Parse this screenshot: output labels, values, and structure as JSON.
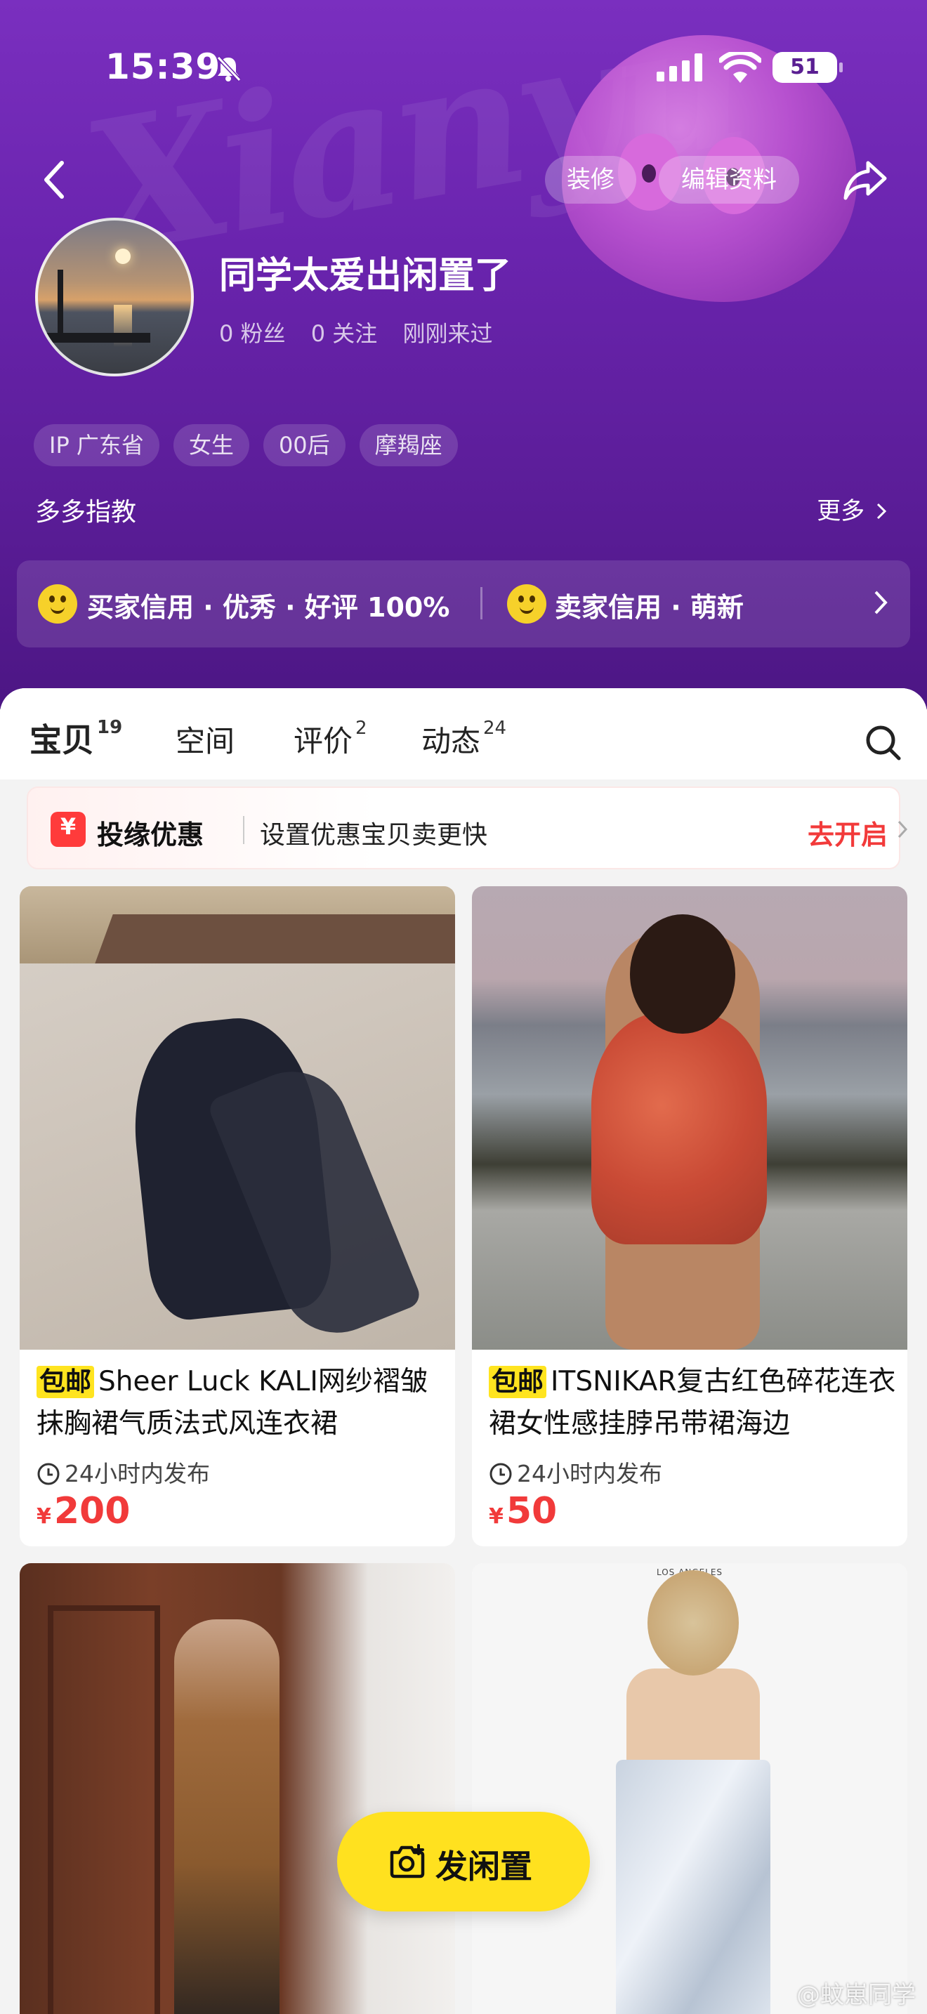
{
  "status_bar": {
    "time": "15:39",
    "battery": "51"
  },
  "header": {
    "background_word": "Xianyu",
    "decorate_label": "装修",
    "edit_label": "编辑资料"
  },
  "profile": {
    "name": "同学太爱出闲置了",
    "followers": "0 粉丝",
    "following": "0 关注",
    "last_seen": "刚刚来过",
    "tags": [
      "IP 广东省",
      "女生",
      "00后",
      "摩羯座"
    ],
    "bio": "多多指教",
    "more_label": "更多"
  },
  "credit": {
    "buyer": "买家信用 · 优秀 · 好评 100%",
    "seller": "卖家信用 · 萌新"
  },
  "tabs": [
    {
      "label": "宝贝",
      "count": "19"
    },
    {
      "label": "空间",
      "count": ""
    },
    {
      "label": "评价",
      "count": "2"
    },
    {
      "label": "动态",
      "count": "24"
    }
  ],
  "promo": {
    "title": "投缘优惠",
    "desc": "设置优惠宝贝卖更快",
    "cta": "去开启"
  },
  "items": [
    {
      "badge": "包邮",
      "title": "Sheer Luck KALI网纱褶皱抹胸裙气质法式风连衣裙",
      "time": "24小时内发布",
      "currency": "¥",
      "price": "200"
    },
    {
      "badge": "包邮",
      "title": "ITSNIKAR复古红色碎花连衣裙女性感挂脖吊带裙海边",
      "time": "24小时内发布",
      "currency": "¥",
      "price": "50"
    },
    {
      "image_text": ""
    },
    {
      "image_text": "LOS ANGELES"
    }
  ],
  "fab": {
    "label": "发闲置"
  },
  "watermark": "@蚊崽同学",
  "colors": {
    "header_purple": "#6a24ae",
    "accent_yellow": "#ffe41f",
    "price_red": "#f13a3a"
  }
}
